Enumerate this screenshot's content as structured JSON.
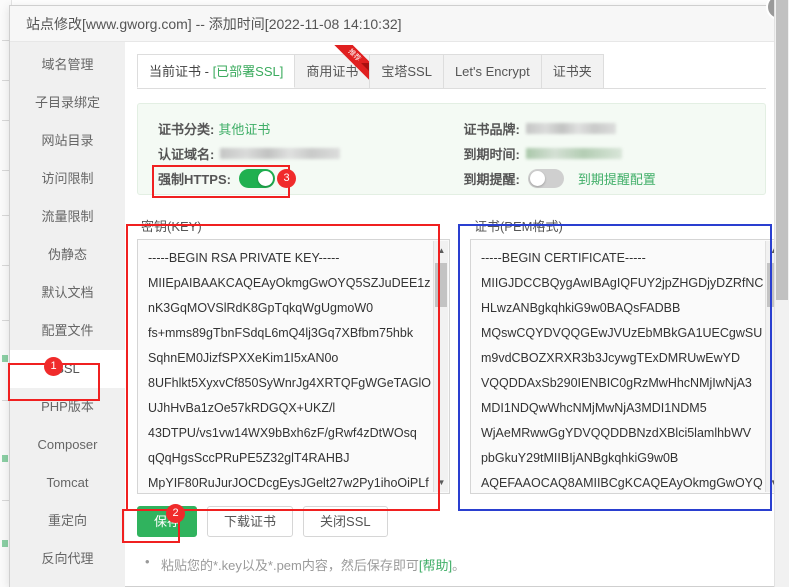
{
  "window": {
    "title": "站点修改[www.gworg.com] -- 添加时间[2022-11-08 14:10:32]",
    "close_label": "✕"
  },
  "sidebar": {
    "items": [
      {
        "label": "域名管理"
      },
      {
        "label": "子目录绑定"
      },
      {
        "label": "网站目录"
      },
      {
        "label": "访问限制"
      },
      {
        "label": "流量限制"
      },
      {
        "label": "伪静态"
      },
      {
        "label": "默认文档"
      },
      {
        "label": "配置文件"
      },
      {
        "label": "SSL"
      },
      {
        "label": "PHP版本"
      },
      {
        "label": "Composer"
      },
      {
        "label": "Tomcat"
      },
      {
        "label": "重定向"
      },
      {
        "label": "反向代理"
      }
    ]
  },
  "tabs": [
    {
      "label": "当前证书 - ",
      "suffix": "[已部署SSL]",
      "active": true
    },
    {
      "label": "商用证书",
      "ribbon": "推荐",
      "active": false
    },
    {
      "label": "宝塔SSL",
      "active": false
    },
    {
      "label": "Let's Encrypt",
      "active": false
    },
    {
      "label": "证书夹",
      "active": false
    }
  ],
  "cert_info": {
    "category_label": "证书分类:",
    "category_value": "其他证书",
    "domain_label": "认证域名:",
    "domain_value": "",
    "force_https_label": "强制HTTPS:",
    "force_https_on": true,
    "brand_label": "证书品牌:",
    "brand_value": "",
    "expire_label": "到期时间:",
    "expire_value": "",
    "remind_label": "到期提醒:",
    "remind_on": false,
    "remind_config_link": "到期提醒配置"
  },
  "key_panel": {
    "label": "密钥(KEY)",
    "lines": [
      "-----BEGIN RSA PRIVATE KEY-----",
      "MIIEpAIBAAKCAQEAyOkmgGwOYQ5SZJuDEE1z",
      "nK3GqMOVSlRdK8GpTqkqWgUgmoW0",
      "fs+mms89gTbnFSdqL6mQ4lj3Gq7XBfbm75hbk",
      "SqhnEM0JizfSPXXeKim1I5xAN0o",
      "8UFhlkt5XyxvCf850SyWnrJg4XRTQFgWGeTAGlO",
      "UJhHvBa1zOe57kRDGQX+UKZ/l",
      "43DTPU/vs1vw14WX9bBxh6zF/gRwf4zDtWOsq",
      "qQqHgsSccPRuPE5Z32glT4RAHBJ",
      "MpYIF80RuJurJOCDcgEysJGelt27w2Py1ihoOiPLf"
    ]
  },
  "pem_panel": {
    "label": "证书(PEM格式)",
    "lines": [
      "-----BEGIN CERTIFICATE-----",
      "MIIGJDCCBQygAwIBAgIQFUY2jpZHGDjyDZRfNC",
      "HLwzANBgkqhkiG9w0BAQsFADBB",
      "MQswCQYDVQQGEwJVUzEbMBkGA1UECgwSU",
      "m9vdCBOZXRXR3b3JcywgTExDMRUwEwYD",
      "VQQDDAxSb290IENBIC0gRzMwHhcNMjIwNjA3",
      "MDI1NDQwWhcNMjMwNjA3MDI1NDM5",
      "WjAeMRwwGgYDVQQDDBNzdXBlci5lamlhbWV",
      "pbGkuY29tMIIBIjANBgkqhkiG9w0B",
      "AQEFAAOCAQ8AMIIBCgKCAQEAyOkmgGwOYQ"
    ]
  },
  "buttons": {
    "save": "保存",
    "download": "下载证书",
    "close_ssl": "关闭SSL"
  },
  "note": {
    "text_before": "粘贴您的*.key以及*.pem内容，然后保存即可",
    "help": "[帮助]",
    "text_after": "。"
  },
  "annotations": {
    "badge_1": "1",
    "badge_2": "2",
    "badge_3": "3"
  },
  "colors": {
    "accent_green": "#30b35e",
    "annotation_red": "#f02020",
    "annotation_blue": "#2a3fd0"
  }
}
